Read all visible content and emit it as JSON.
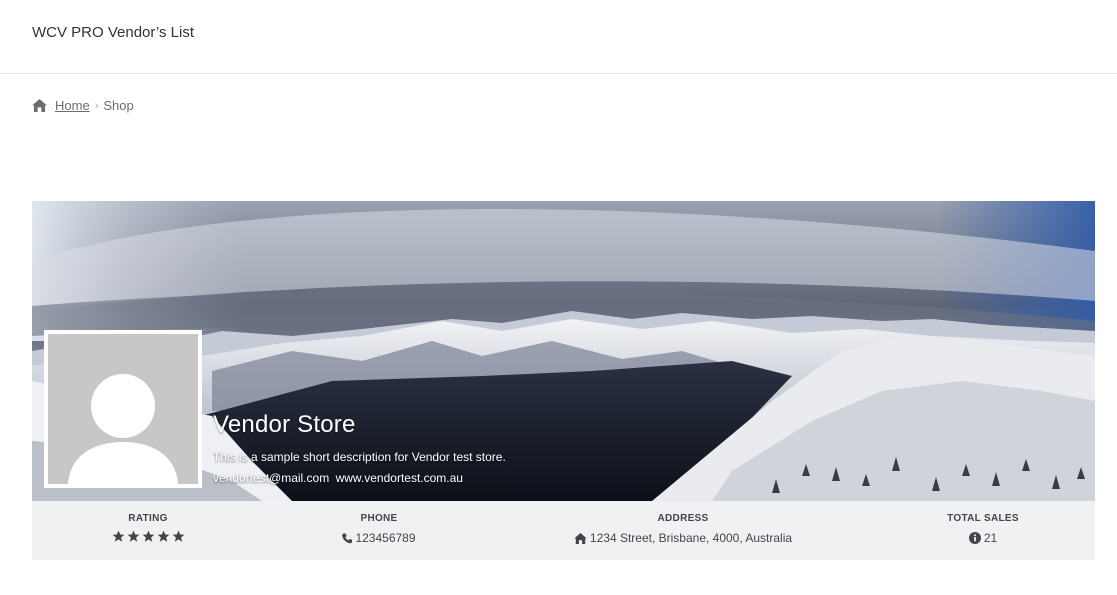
{
  "header": {
    "site_title": "WCV PRO Vendor’s List"
  },
  "breadcrumb": {
    "home_label": "Home",
    "separator": "›",
    "current": "Shop"
  },
  "store": {
    "name": "Vendor Store",
    "description": "This is a sample short description for Vendor test store.",
    "email": "vendortest@mail.com",
    "website": "www.vendortest.com.au"
  },
  "stats": {
    "rating": {
      "label": "RATING",
      "stars": 5
    },
    "phone": {
      "label": "PHONE",
      "value": "123456789",
      "icon": "phone-icon"
    },
    "address": {
      "label": "ADDRESS",
      "value": "1234 Street, Brisbane, 4000, Australia",
      "icon": "home-icon"
    },
    "total_sales": {
      "label": "TOTAL SALES",
      "value": "21",
      "icon": "info-icon"
    }
  },
  "colors": {
    "stats_bg": "#f0f1f2",
    "text": "#43454b",
    "avatar_bg": "#c7c7c7"
  }
}
